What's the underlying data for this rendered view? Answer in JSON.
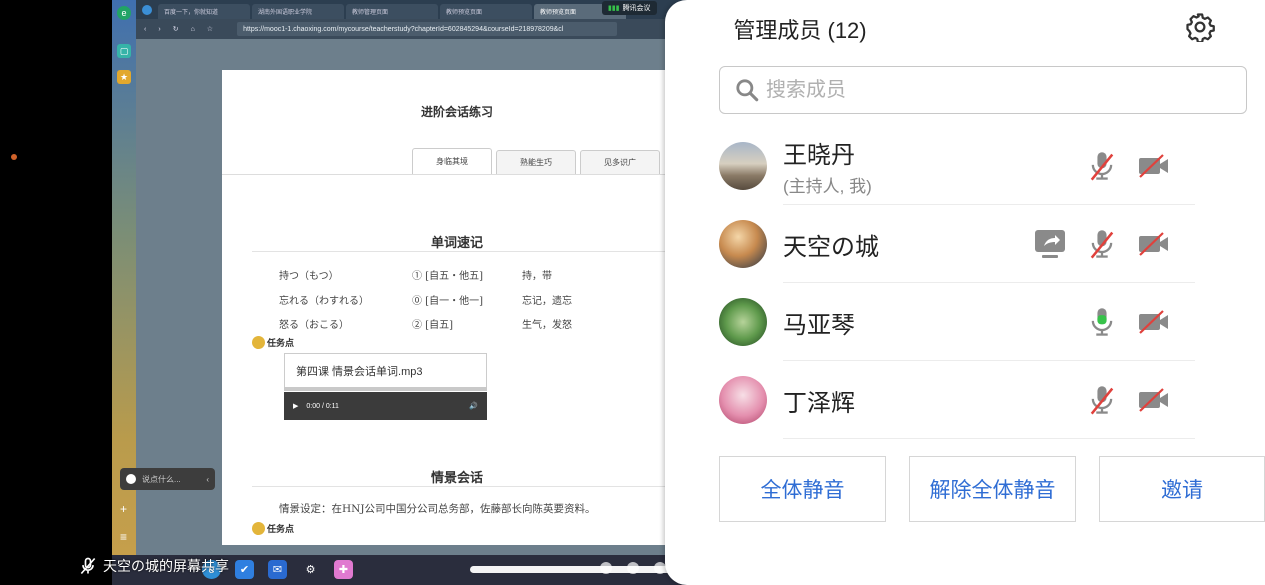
{
  "shared_screen": {
    "browser_tabs": [
      {
        "label": "百度一下，你就知道",
        "active": false
      },
      {
        "label": "湖南外国语职业学院",
        "active": false
      },
      {
        "label": "教师管理页面",
        "active": false
      },
      {
        "label": "教师预览页面",
        "active": false
      },
      {
        "label": "教师预览页面",
        "active": true
      }
    ],
    "meeting_tag": "腾讯会议",
    "url": "https://mooc1-1.chaoxing.com/mycourse/teacherstudy?chapterId=602845294&courseId=218978209&cl",
    "page_title": "进阶会话练习",
    "page_tabs": [
      "身临其境",
      "熟能生巧",
      "见多识广"
    ],
    "section1_title": "单词速记",
    "vocab": [
      {
        "word": "持つ（もつ）",
        "type": "① [自五・他五]",
        "meaning": "持，带"
      },
      {
        "word": "忘れる（わすれる）",
        "type": "⓪ [自一・他一]",
        "meaning": "忘记，遗忘"
      },
      {
        "word": "怒る（おこる）",
        "type": "② [自五]",
        "meaning": "生气，发怒"
      }
    ],
    "task_label": "任务点",
    "audio_file": "第四课 情景会话单词.mp3",
    "audio_time": "0:00 / 0:11",
    "section2_title": "情景会话",
    "scene_text": "情景设定：在HNJ公司中国分公司总务部，佐藤部长向陈英要资料。",
    "chat_placeholder": "说点什么...",
    "share_label": "天空の城的屏幕共享"
  },
  "panel": {
    "title": "管理成员 (12)",
    "search_placeholder": "搜索成员",
    "members": [
      {
        "name": "王晓丹",
        "role": "(主持人, 我)",
        "sharing": false,
        "mic": "muted",
        "camera": "off"
      },
      {
        "name": "天空の城",
        "role": "",
        "sharing": true,
        "mic": "muted",
        "camera": "off"
      },
      {
        "name": "马亚琴",
        "role": "",
        "sharing": false,
        "mic": "active",
        "camera": "off"
      },
      {
        "name": "丁泽辉",
        "role": "",
        "sharing": false,
        "mic": "muted",
        "camera": "off"
      }
    ],
    "buttons": {
      "mute_all": "全体静音",
      "unmute_all": "解除全体静音",
      "invite": "邀请"
    },
    "accent_color": "#2f6dd4",
    "mic_active_color": "#37c24a"
  }
}
